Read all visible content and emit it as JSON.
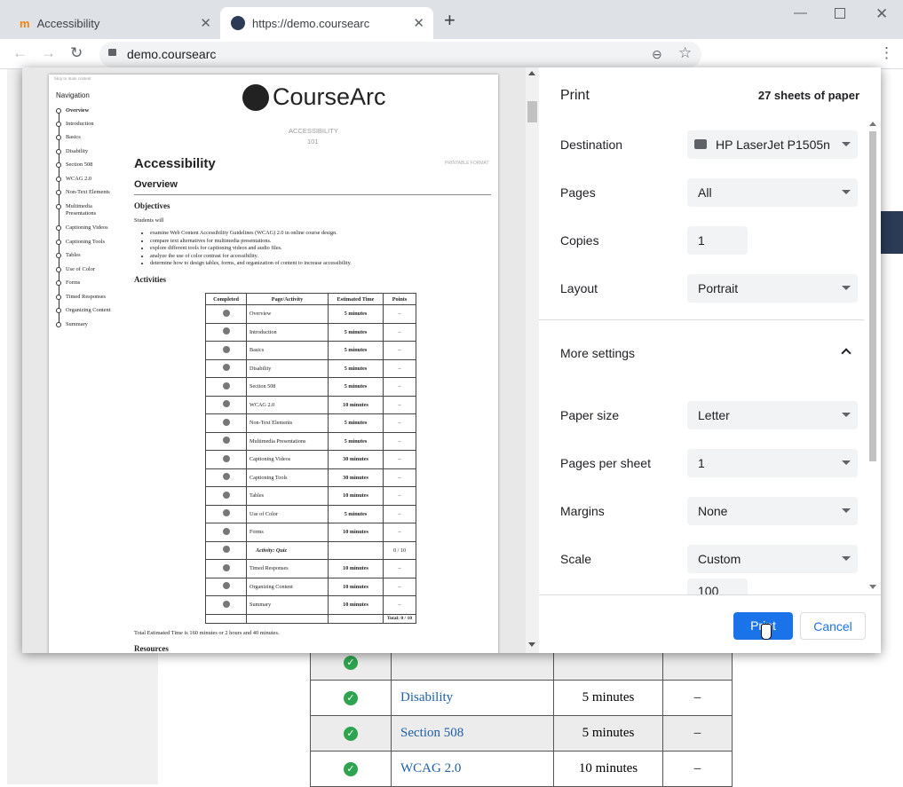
{
  "browser": {
    "tabs": [
      {
        "label": "Accessibility"
      },
      {
        "label": "https://demo.coursearc"
      }
    ],
    "url": "demo.coursearc"
  },
  "background_page": {
    "rows": [
      {
        "activity": "Disability",
        "time": "5 minutes",
        "points": "–"
      },
      {
        "activity": "Section 508",
        "time": "5 minutes",
        "points": "–"
      },
      {
        "activity": "WCAG 2.0",
        "time": "10 minutes",
        "points": "–"
      }
    ]
  },
  "preview": {
    "skip_link": "Skip to main content",
    "logo_text": "CourseArc",
    "course_name": "ACCESSIBILITY",
    "course_number": "101",
    "printable": "PRINTABLE FORMAT",
    "nav_heading": "Navigation",
    "nav_items": [
      "Overview",
      "Introduction",
      "Basics",
      "Disability",
      "Section 508",
      "WCAG 2.0",
      "Non-Text Elements",
      "Multimedia Presentations",
      "Captioning Videos",
      "Captioning Tools",
      "Tables",
      "Use of Color",
      "Forms",
      "Timed Responses",
      "Organizing Content",
      "Summary"
    ],
    "title": "Accessibility",
    "subtitle": "Overview",
    "objectives_heading": "Objectives",
    "students_will": "Students will",
    "objectives": [
      "examine Web Content Accessibility Guidelines (WCAG) 2.0 in online course design.",
      "compare text alternatives for multimedia presentations.",
      "explore different tools for captioning videos and audio files.",
      "analyze the use of color contrast for accessibility.",
      "determine how to design tables, forms, and organization of content to increase accessibility."
    ],
    "activities_heading": "Activities",
    "table_headers": [
      "Completed",
      "Page/Activity",
      "Estimated Time",
      "Points"
    ],
    "table_rows": [
      {
        "page": "Overview",
        "time": "5 minutes",
        "points": "–"
      },
      {
        "page": "Introduction",
        "time": "5 minutes",
        "points": "–"
      },
      {
        "page": "Basics",
        "time": "5 minutes",
        "points": "–"
      },
      {
        "page": "Disability",
        "time": "5 minutes",
        "points": "–"
      },
      {
        "page": "Section 508",
        "time": "5 minutes",
        "points": "–"
      },
      {
        "page": "WCAG 2.0",
        "time": "10 minutes",
        "points": "–"
      },
      {
        "page": "Non-Text Elements",
        "time": "5 minutes",
        "points": "–"
      },
      {
        "page": "Multimedia Presentations",
        "time": "5 minutes",
        "points": "–"
      },
      {
        "page": "Captioning Videos",
        "time": "30 minutes",
        "points": "–"
      },
      {
        "page": "Captioning Tools",
        "time": "30 minutes",
        "points": "–"
      },
      {
        "page": "Tables",
        "time": "10 minutes",
        "points": "–"
      },
      {
        "page": "Use of Color",
        "time": "5 minutes",
        "points": "–"
      },
      {
        "page": "Forms",
        "time": "10 minutes",
        "points": "–"
      },
      {
        "page": "Activity: Quiz",
        "time": "",
        "points": "0 / 10"
      },
      {
        "page": "Timed Responses",
        "time": "10 minutes",
        "points": "–"
      },
      {
        "page": "Organizing Content",
        "time": "10 minutes",
        "points": "–"
      },
      {
        "page": "Summary",
        "time": "10 minutes",
        "points": "–"
      }
    ],
    "total": "Total: 0 / 10",
    "total_time": "Total Estimated Time is 160 minutes or 2 hours and 40 minutes.",
    "resources_heading": "Resources"
  },
  "print": {
    "title": "Print",
    "sheets": "27 sheets of paper",
    "destination_label": "Destination",
    "destination_value": "HP LaserJet P1505n",
    "pages_label": "Pages",
    "pages_value": "All",
    "copies_label": "Copies",
    "copies_value": "1",
    "layout_label": "Layout",
    "layout_value": "Portrait",
    "more_settings_label": "More settings",
    "paper_size_label": "Paper size",
    "paper_size_value": "Letter",
    "pps_label": "Pages per sheet",
    "pps_value": "1",
    "margins_label": "Margins",
    "margins_value": "None",
    "scale_label": "Scale",
    "scale_select_value": "Custom",
    "scale_value": "100",
    "print_button": "Print",
    "cancel_button": "Cancel"
  },
  "colors": {
    "accent": "#1a73e8"
  }
}
